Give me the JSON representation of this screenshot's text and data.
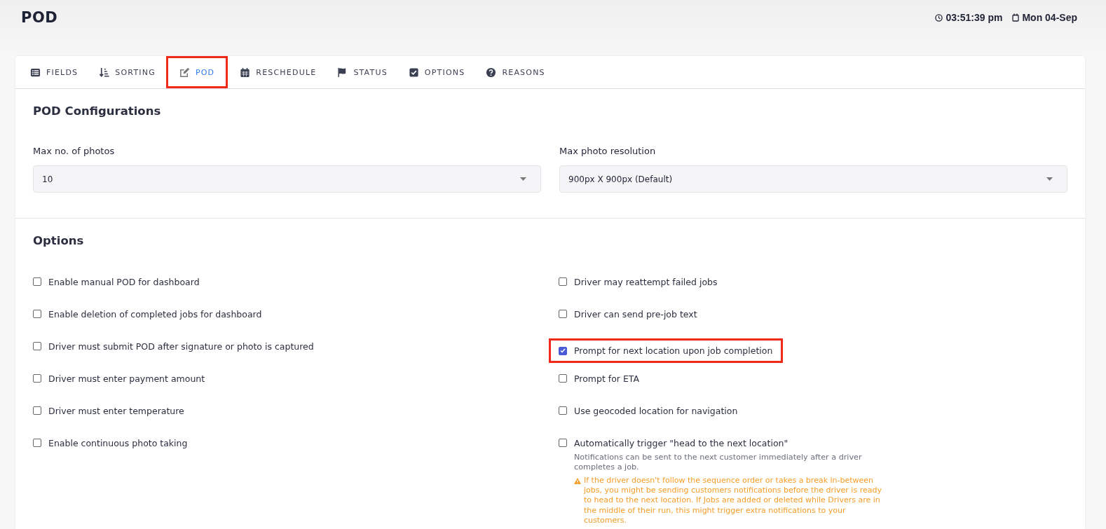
{
  "header": {
    "title": "POD",
    "time": "03:51:39 pm",
    "date": "Mon 04-Sep"
  },
  "tabs": [
    {
      "label": "FIELDS",
      "kind": "list",
      "selected": false,
      "highlighted": false
    },
    {
      "label": "SORTING",
      "kind": "sort",
      "selected": false,
      "highlighted": false
    },
    {
      "label": "POD",
      "kind": "edit",
      "selected": true,
      "highlighted": true
    },
    {
      "label": "RESCHEDULE",
      "kind": "calendar",
      "selected": false,
      "highlighted": false
    },
    {
      "label": "STATUS",
      "kind": "flag",
      "selected": false,
      "highlighted": false
    },
    {
      "label": "OPTIONS",
      "kind": "check",
      "selected": false,
      "highlighted": false
    },
    {
      "label": "REASONS",
      "kind": "question",
      "selected": false,
      "highlighted": false
    }
  ],
  "configurations": {
    "title": "POD Configurations",
    "fields": [
      {
        "label": "Max no. of photos",
        "value": "10"
      },
      {
        "label": "Max photo resolution",
        "value": "900px X 900px (Default)"
      }
    ]
  },
  "options": {
    "title": "Options",
    "rows": [
      [
        {
          "label": "Enable manual POD for dashboard",
          "checked": false,
          "highlighted": false
        },
        {
          "label": "Driver may reattempt failed jobs",
          "checked": false,
          "highlighted": false
        }
      ],
      [
        {
          "label": "Enable deletion of completed jobs for dashboard",
          "checked": false,
          "highlighted": false
        },
        {
          "label": "Driver can send pre-job text",
          "checked": false,
          "highlighted": false
        }
      ],
      [
        {
          "label": "Driver must submit POD after signature or photo is captured",
          "checked": false,
          "highlighted": false
        },
        {
          "label": "Prompt for next location upon job completion",
          "checked": true,
          "highlighted": true
        }
      ],
      [
        {
          "label": "Driver must enter payment amount",
          "checked": false,
          "highlighted": false
        },
        {
          "label": "Prompt for ETA",
          "checked": false,
          "highlighted": false
        }
      ],
      [
        {
          "label": "Driver must enter temperature",
          "checked": false,
          "highlighted": false
        },
        {
          "label": "Use geocoded location for navigation",
          "checked": false,
          "highlighted": false
        }
      ],
      [
        {
          "label": "Enable continuous photo taking",
          "checked": false,
          "highlighted": false
        },
        {
          "label": "Automatically trigger \"head to the next location\"",
          "checked": false,
          "highlighted": false,
          "description": "Notifications can be sent to the next customer immediately after a driver completes a job.",
          "warning": "If the driver doesn't follow the sequence order or takes a break in-between jobs, you might be sending customers notifications before the driver is ready to head to the next location. If Jobs are added or deleted while Drivers are in the middle of their run, this might trigger extra notifications to your customers."
        }
      ]
    ]
  }
}
